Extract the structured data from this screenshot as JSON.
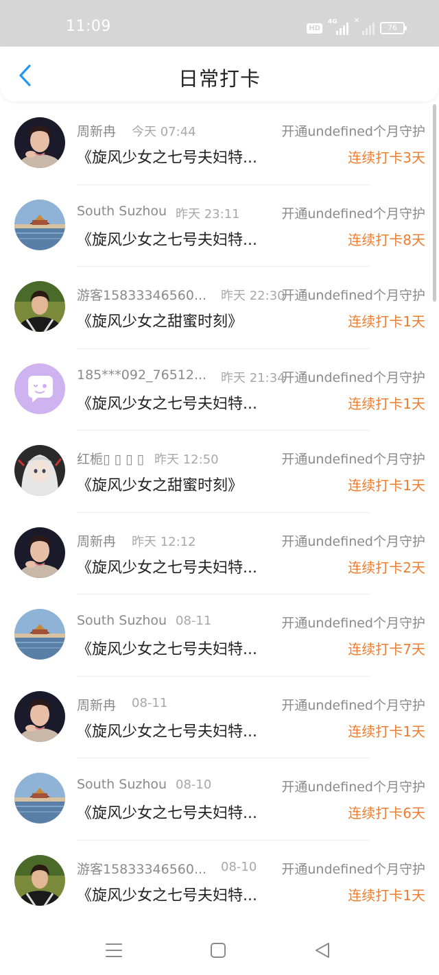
{
  "status_bar": {
    "time": "11:09",
    "hd_label": "HD",
    "network_label": "4G",
    "battery": "76"
  },
  "header": {
    "title": "日常打卡",
    "back_icon": "chevron-left-icon",
    "accent_color": "#2196f3"
  },
  "colors": {
    "streak": "#f07c2e",
    "muted_text": "#8a8a8a"
  },
  "entries": [
    {
      "name": "周新冉",
      "time": "今天 07:44",
      "guard": "开通undefined个月守护",
      "book": "《旋风少女之七号夫妇特...",
      "streak": "连续打卡3天",
      "avatar": "portrait-woman"
    },
    {
      "name": "South Suzhou",
      "time": "昨天 23:11",
      "guard": "开通undefined个月守护",
      "book": "《旋风少女之七号夫妇特...",
      "streak": "连续打卡8天",
      "avatar": "palace-landscape"
    },
    {
      "name": "游客15833346560...",
      "time": "昨天 22:30",
      "guard": "开通undefined个月守护",
      "book": "《旋风少女之甜蜜时刻》",
      "streak": "连续打卡1天",
      "avatar": "portrait-young-man"
    },
    {
      "name": "185***092_76512...",
      "time": "昨天 21:34",
      "guard": "开通undefined个月守护",
      "book": "《旋风少女之七号夫妇特...",
      "streak": "连续打卡1天",
      "avatar": "default-chat-bubble"
    },
    {
      "name": "红栀▯ ▯ ▯ ▯",
      "time": "昨天 12:50",
      "guard": "开通undefined个月守护",
      "book": "《旋风少女之甜蜜时刻》",
      "streak": "连续打卡1天",
      "avatar": "anime-girl"
    },
    {
      "name": "周新冉",
      "time": "昨天 12:12",
      "guard": "开通undefined个月守护",
      "book": "《旋风少女之七号夫妇特...",
      "streak": "连续打卡2天",
      "avatar": "portrait-woman"
    },
    {
      "name": "South Suzhou",
      "time": "08-11",
      "guard": "开通undefined个月守护",
      "book": "《旋风少女之七号夫妇特...",
      "streak": "连续打卡7天",
      "avatar": "palace-landscape"
    },
    {
      "name": "周新冉",
      "time": "08-11",
      "guard": "开通undefined个月守护",
      "book": "《旋风少女之七号夫妇特...",
      "streak": "连续打卡1天",
      "avatar": "portrait-woman"
    },
    {
      "name": "South Suzhou",
      "time": "08-10",
      "guard": "开通undefined个月守护",
      "book": "《旋风少女之七号夫妇特...",
      "streak": "连续打卡6天",
      "avatar": "palace-landscape"
    },
    {
      "name": "游客15833346560...",
      "time": "08-10",
      "guard": "开通undefined个月守护",
      "book": "《旋风少女之七号夫妇特...",
      "streak": "连续打卡1天",
      "avatar": "portrait-young-man"
    }
  ],
  "nav_bar": {
    "menu_icon": "menu-icon",
    "home_icon": "home-square-icon",
    "back_icon": "back-triangle-icon"
  }
}
